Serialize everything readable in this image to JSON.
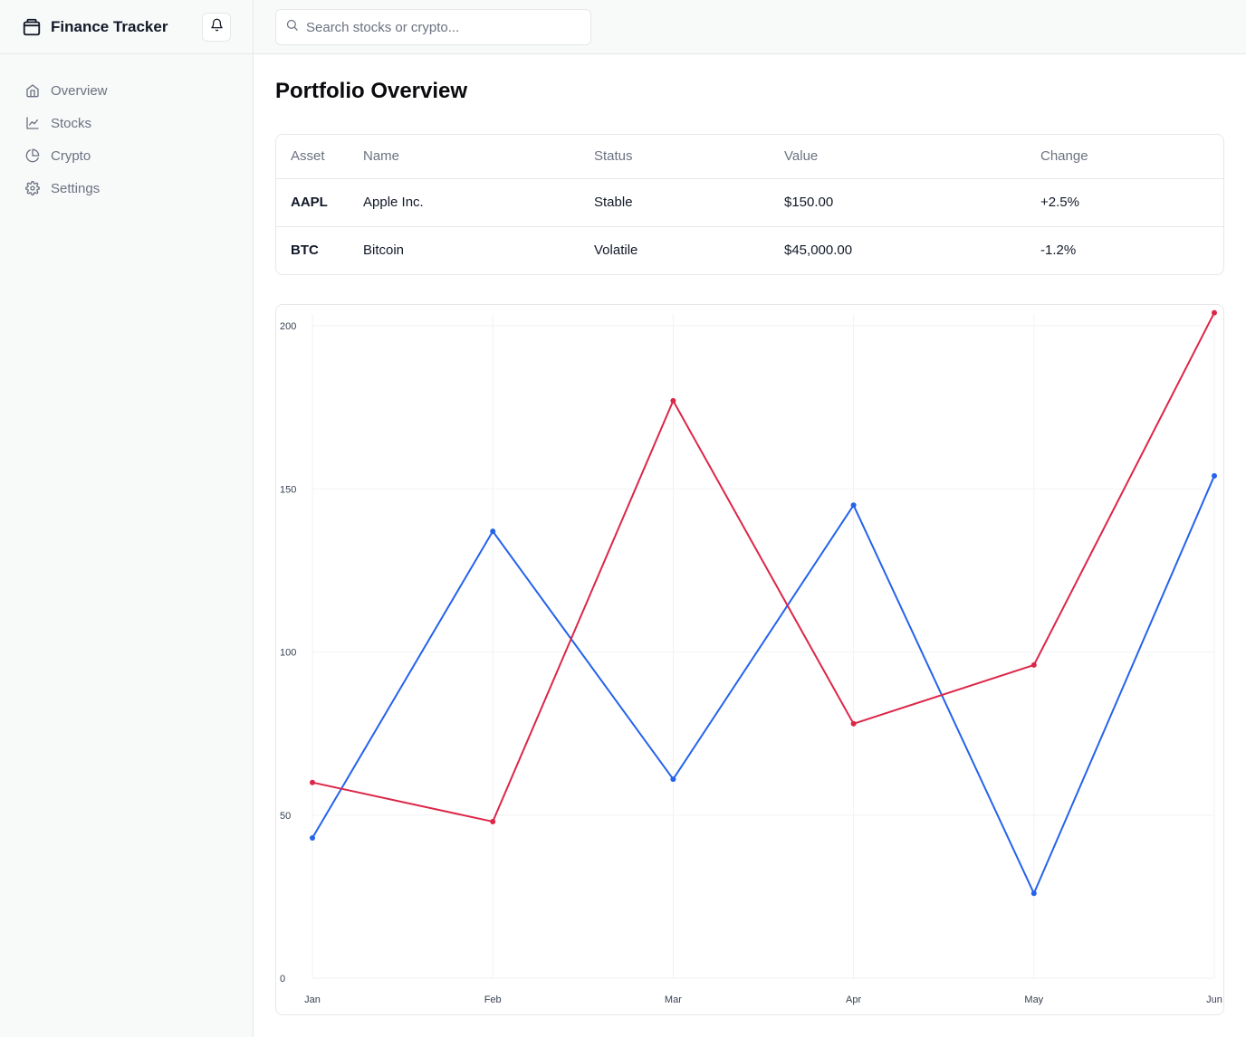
{
  "app": {
    "title": "Finance Tracker"
  },
  "search": {
    "placeholder": "Search stocks or crypto..."
  },
  "nav": [
    {
      "label": "Overview",
      "icon": "home-icon"
    },
    {
      "label": "Stocks",
      "icon": "line-chart-icon"
    },
    {
      "label": "Crypto",
      "icon": "pie-chart-icon"
    },
    {
      "label": "Settings",
      "icon": "gear-icon"
    }
  ],
  "page": {
    "title": "Portfolio Overview"
  },
  "table": {
    "headers": [
      "Asset",
      "Name",
      "Status",
      "Value",
      "Change"
    ],
    "rows": [
      [
        "AAPL",
        "Apple Inc.",
        "Stable",
        "$150.00",
        "+2.5%"
      ],
      [
        "BTC",
        "Bitcoin",
        "Volatile",
        "$45,000.00",
        "-1.2%"
      ]
    ]
  },
  "chart_data": {
    "type": "line",
    "x": [
      "Jan",
      "Feb",
      "Mar",
      "Apr",
      "May",
      "Jun"
    ],
    "y_ticks": [
      0,
      50,
      100,
      150,
      200
    ],
    "ylim": [
      0,
      200
    ],
    "grid": true,
    "series": [
      {
        "color": "#2563eb",
        "values": [
          43,
          137,
          61,
          145,
          26,
          154
        ]
      },
      {
        "color": "#dc2648",
        "values": [
          60,
          48,
          177,
          78,
          96,
          204
        ]
      }
    ]
  }
}
